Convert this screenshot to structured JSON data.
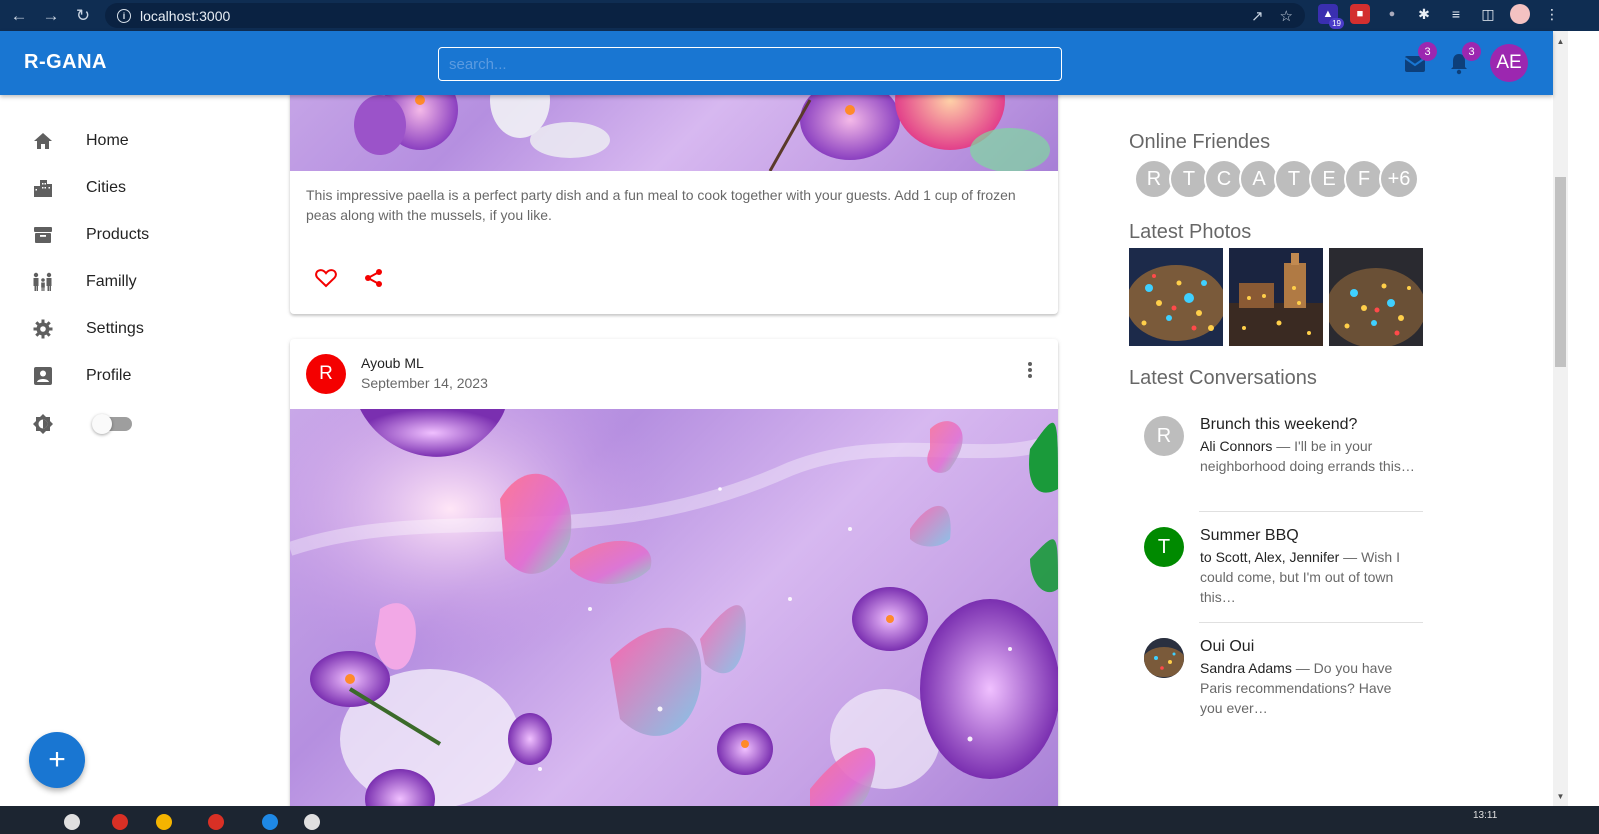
{
  "browser": {
    "url": "localhost:3000",
    "extension_badge": "19"
  },
  "appbar": {
    "brand": "R-GANA",
    "search_placeholder": "search...",
    "mail_count": "3",
    "notification_count": "3",
    "user_initials": "AE",
    "accent_color": "#1976d2",
    "badge_color": "#9c27b0"
  },
  "sidebar": {
    "items": [
      {
        "label": "Home",
        "icon": "home-icon"
      },
      {
        "label": "Cities",
        "icon": "city-icon"
      },
      {
        "label": "Products",
        "icon": "archive-icon"
      },
      {
        "label": "Familly",
        "icon": "family-icon"
      },
      {
        "label": "Settings",
        "icon": "gear-icon"
      },
      {
        "label": "Profile",
        "icon": "account-box-icon"
      }
    ],
    "theme_toggle_icon": "brightness-icon",
    "fab_label": "+"
  },
  "feed": {
    "posts": [
      {
        "text": "This impressive paella is a perfect party dish and a fun meal to cook together with your guests. Add 1 cup of frozen peas along with the mussels, if you like."
      },
      {
        "avatar_letter": "R",
        "avatar_color": "#f40000",
        "author": "Ayoub ML",
        "date": "September 14, 2023"
      }
    ],
    "like_color": "#f40000"
  },
  "right_panel": {
    "online_title": "Online Friendes",
    "online_friends": [
      "R",
      "T",
      "C",
      "A",
      "T",
      "E",
      "F",
      "+6"
    ],
    "photos_title": "Latest Photos",
    "conversations_title": "Latest Conversations",
    "conversations": [
      {
        "avatar": "R",
        "avatar_color": "#bdbdbd",
        "title": "Brunch this weekend?",
        "who": "Ali Connors",
        "snippet": " — I'll be in your neighborhood doing errands this…"
      },
      {
        "avatar": "T",
        "avatar_color": "#008a00",
        "title": "Summer BBQ",
        "who": "to Scott, Alex, Jennifer",
        "snippet": " — Wish I could come, but I'm out of town this…"
      },
      {
        "avatar": "",
        "avatar_color": "#3a3a3a",
        "title": "Oui Oui",
        "who": "Sandra Adams",
        "snippet": " — Do you have Paris recommendations? Have you ever…"
      }
    ]
  },
  "taskbar": {
    "time": "13:11"
  }
}
